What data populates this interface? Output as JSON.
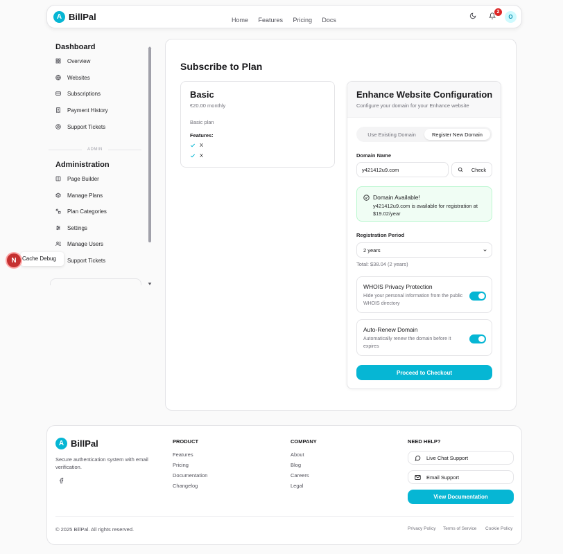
{
  "header": {
    "logo_letter": "A",
    "brand": "BillPal",
    "nav": [
      "Home",
      "Features",
      "Pricing",
      "Docs"
    ],
    "notification_count": "2",
    "avatar_letter": "O"
  },
  "sidebar": {
    "dashboard_title": "Dashboard",
    "dashboard_items": [
      {
        "label": "Overview",
        "icon": "grid-icon"
      },
      {
        "label": "Websites",
        "icon": "globe-icon"
      },
      {
        "label": "Subscriptions",
        "icon": "credit-card-icon"
      },
      {
        "label": "Payment History",
        "icon": "receipt-icon"
      },
      {
        "label": "Support Tickets",
        "icon": "lifebuoy-icon"
      }
    ],
    "divider_label": "ADMIN",
    "admin_title": "Administration",
    "admin_items": [
      {
        "label": "Page Builder",
        "icon": "layout-icon"
      },
      {
        "label": "Manage Plans",
        "icon": "package-icon"
      },
      {
        "label": "Plan Categories",
        "icon": "shapes-icon"
      },
      {
        "label": "Settings",
        "icon": "sliders-icon"
      },
      {
        "label": "Manage Users",
        "icon": "users-icon"
      },
      {
        "label": "Support Tickets",
        "icon": "lifebuoy-icon"
      }
    ]
  },
  "debug": {
    "badge_letter": "N",
    "tooltip": "w Cache Debug"
  },
  "main": {
    "title": "Subscribe to Plan",
    "plan": {
      "name": "Basic",
      "price": "€20.00 monthly",
      "description": "Basic plan",
      "features_label": "Features:",
      "features": [
        "X",
        "X"
      ]
    },
    "config": {
      "title": "Enhance Website Configuration",
      "subtitle": "Configure your domain for your Enhance website",
      "tabs": [
        "Use Existing Domain",
        "Register New Domain"
      ],
      "active_tab": "Register New Domain",
      "domain_label": "Domain Name",
      "domain_value": "y421412u9.com",
      "check_label": "Check",
      "available_title": "Domain Available!",
      "available_text": "y421412u9.com is available for registration at $19.02/year",
      "period_label": "Registration Period",
      "period_value": "2 years",
      "total": "Total: $38.04 (2 years)",
      "whois_title": "WHOIS Privacy Protection",
      "whois_desc": "Hide your personal information from the public WHOIS directory",
      "whois_on": true,
      "renew_title": "Auto-Renew Domain",
      "renew_desc": "Automatically renew the domain before it expires",
      "renew_on": true,
      "checkout_label": "Proceed to Checkout"
    }
  },
  "footer": {
    "logo_letter": "A",
    "brand": "BillPal",
    "tagline": "Secure authentication system with email verification.",
    "product_title": "PRODUCT",
    "product_links": [
      "Features",
      "Pricing",
      "Documentation",
      "Changelog"
    ],
    "company_title": "COMPANY",
    "company_links": [
      "About",
      "Blog",
      "Careers",
      "Legal"
    ],
    "help_title": "NEED HELP?",
    "live_chat": "Live Chat Support",
    "email_support": "Email Support",
    "docs_button": "View Documentation",
    "copyright": "© 2025 BillPal. All rights reserved.",
    "legal_links": [
      "Privacy Policy",
      "Terms of Service",
      "Cookie Policy"
    ]
  },
  "colors": {
    "accent": "#06b6d4",
    "success_bg": "#f0fdf4",
    "badge": "#dc2626"
  }
}
